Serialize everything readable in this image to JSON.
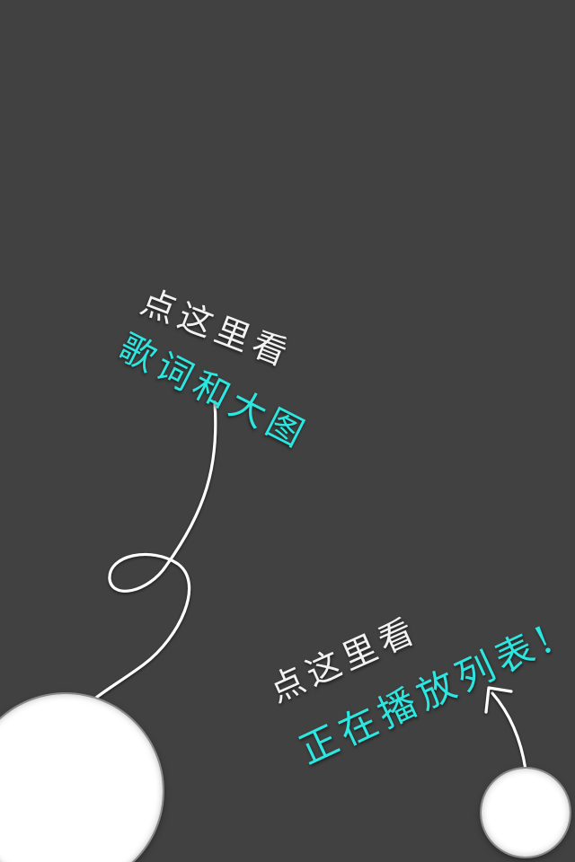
{
  "overlay": {
    "background_color": "#414141",
    "text_color": "#f2f2f2",
    "accent_color": "#2ee6e0",
    "hint_lyrics": {
      "line1": "点这里看",
      "line2": "歌词和大图"
    },
    "hint_playlist": {
      "line1": "点这里看",
      "line2": "正在播放列表!"
    }
  }
}
